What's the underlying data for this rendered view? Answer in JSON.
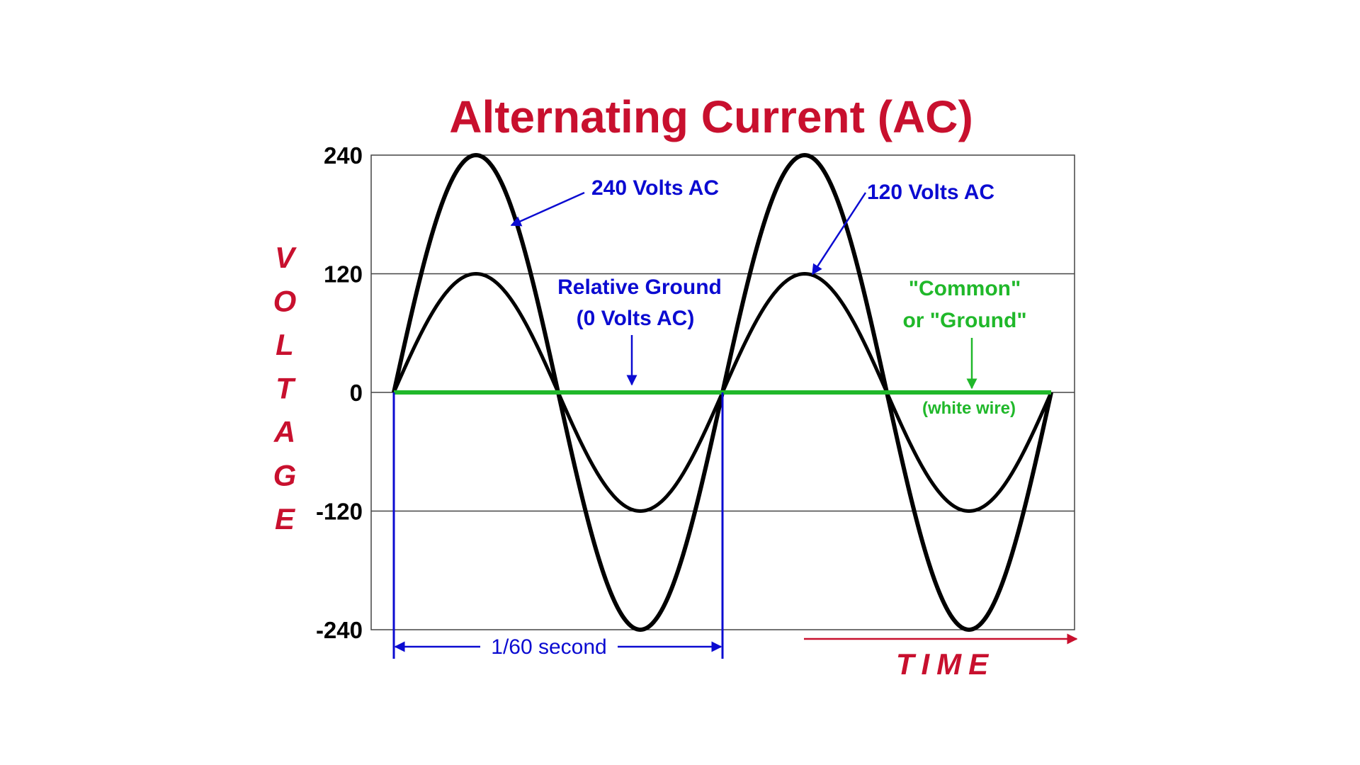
{
  "chart_data": {
    "type": "line",
    "title": "Alternating Current (AC)",
    "ylabel": "VOLTAGE",
    "xlabel": "TIME",
    "ylim": [
      -240,
      240
    ],
    "yticks": [
      240,
      120,
      0,
      -120,
      -240
    ],
    "ytick_labels": [
      "240",
      "120",
      "0",
      "-120",
      "-240"
    ],
    "grid": true,
    "cycles": 2,
    "series": [
      {
        "name": "240 Volts AC",
        "amplitude": 240,
        "color": "#000000"
      },
      {
        "name": "120 Volts AC",
        "amplitude": 120,
        "color": "#000000"
      },
      {
        "name": "Relative Ground (0 Volts AC)",
        "amplitude": 0,
        "color": "#20b82a"
      }
    ],
    "annotations": {
      "v240": "240 Volts AC",
      "v120": "120 Volts AC",
      "ground_line1": "Relative Ground",
      "ground_line2": "(0 Volts AC)",
      "common_line1": "\"Common\"",
      "common_line2": "or \"Ground\"",
      "white_wire": "(white wire)",
      "period": "1/60 second"
    },
    "colors": {
      "title": "#c8102e",
      "axis_label": "#c8102e",
      "annotation_blue": "#0b0bd1",
      "ground_green": "#20b82a",
      "wave": "#000000"
    }
  }
}
